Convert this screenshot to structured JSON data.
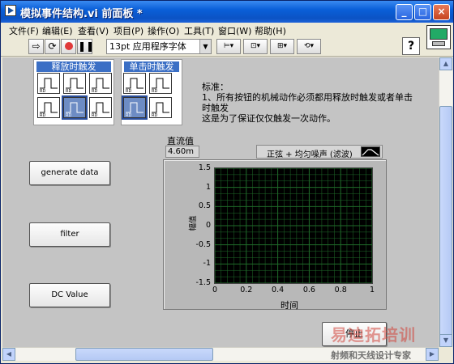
{
  "window": {
    "title": "模拟事件结构.vi 前面板 *",
    "controls": {
      "minimize": "_",
      "maximize": "□",
      "close": "×"
    }
  },
  "menu": {
    "items": [
      "文件(F)",
      "编辑(E)",
      "查看(V)",
      "项目(P)",
      "操作(O)",
      "工具(T)",
      "窗口(W)",
      "帮助(H)"
    ]
  },
  "toolbar": {
    "run_icon": "run-arrow-icon",
    "run_continuous_icon": "run-continuous-icon",
    "abort_icon": "abort-icon",
    "pause_icon": "pause-icon",
    "font_label": "13pt 应用程序字体",
    "help_label": "?"
  },
  "mechanical_actions": {
    "release_header": "释放时触发",
    "single_header": "单击时触发"
  },
  "note": {
    "line1": "标准：",
    "line2": "1、所有按钮的机械动作必须都用释放时触发或者单击时触发",
    "line3": "这是为了保证仅仅触发一次动作。"
  },
  "buttons": {
    "generate": "generate data",
    "filter": "filter",
    "dc_value": "DC Value",
    "stop": "停止"
  },
  "dc_indicator": {
    "label": "直流值",
    "value": "4.60m"
  },
  "graph": {
    "legend_label": "正弦 + 均匀噪声 (滤波)",
    "xlabel": "时间",
    "ylabel": "幅值",
    "yticks": [
      "1.5",
      "1",
      "0.5",
      "0",
      "-0.5",
      "-1",
      "-1.5"
    ],
    "xticks": [
      "0",
      "0.2",
      "0.4",
      "0.6",
      "0.8",
      "1"
    ]
  },
  "chart_data": {
    "type": "line",
    "title": "",
    "xlabel": "时间",
    "ylabel": "幅值",
    "xlim": [
      0,
      1
    ],
    "ylim": [
      -1.5,
      1.5
    ],
    "grid": true,
    "series": [
      {
        "name": "正弦 + 均匀噪声 (滤波)",
        "x": [],
        "y": []
      }
    ]
  },
  "watermark": {
    "line1": "易迪拓培训",
    "line2": "射频和天线设计专家"
  },
  "colors": {
    "plot_bg": "#000000",
    "grid": "#1f6b2a",
    "header_bg": "#3b6fc5",
    "panel_bg": "#c4c4c4"
  }
}
